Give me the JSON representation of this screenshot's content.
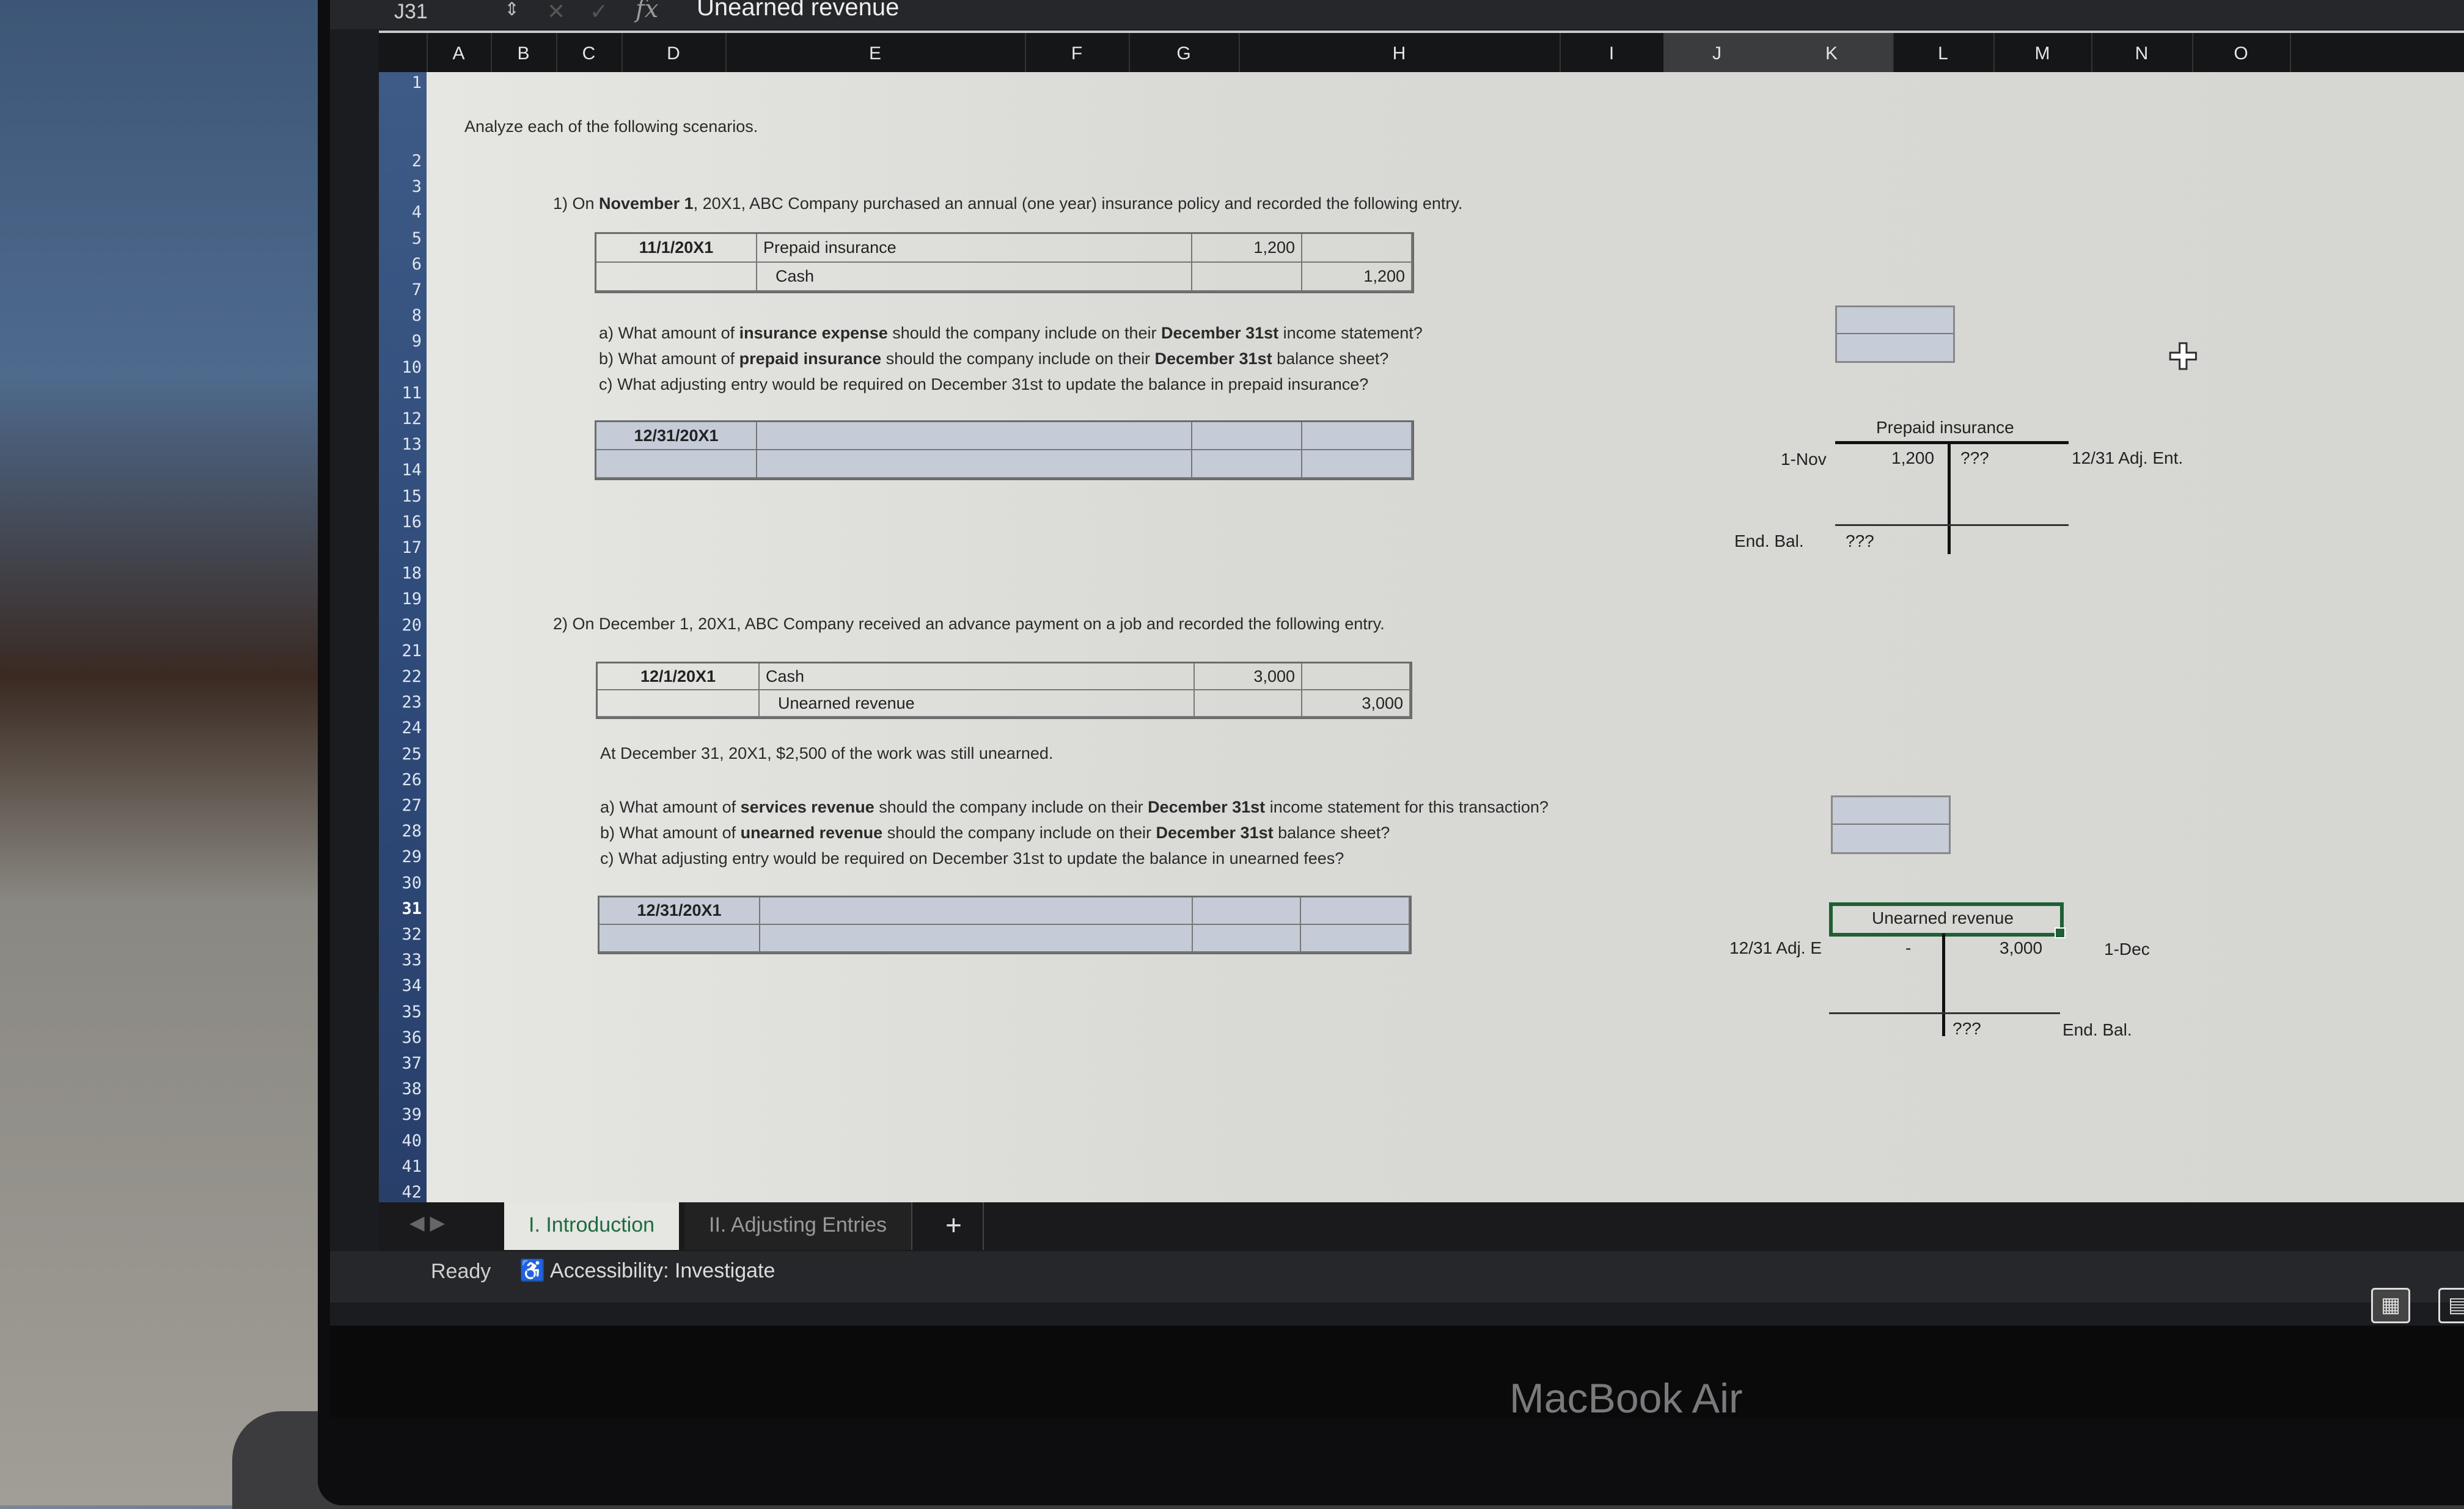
{
  "formula_bar": {
    "name_box": "J31",
    "fx_label": "fx",
    "content": "Unearned revenue"
  },
  "columns": [
    "A",
    "B",
    "C",
    "D",
    "E",
    "F",
    "G",
    "H",
    "I",
    "J",
    "K",
    "L",
    "M",
    "N",
    "O"
  ],
  "selected_columns": [
    "J",
    "K"
  ],
  "rows": [
    "1",
    "2",
    "3",
    "4",
    "5",
    "6",
    "7",
    "8",
    "9",
    "10",
    "11",
    "12",
    "13",
    "14",
    "15",
    "16",
    "17",
    "18",
    "19",
    "20",
    "21",
    "22",
    "23",
    "24",
    "25",
    "26",
    "27",
    "28",
    "29",
    "30",
    "31",
    "32",
    "33",
    "34",
    "35",
    "36",
    "37",
    "38",
    "39",
    "40",
    "41",
    "42"
  ],
  "selected_row": "31",
  "intro": "Analyze each of the following scenarios.",
  "scenario1": {
    "prompt_num": "1) On ",
    "prompt_bold": "November 1",
    "prompt_rest": ", 20X1, ABC Company purchased an annual (one year) insurance policy and recorded the following entry.",
    "entry": [
      {
        "date": "11/1/20X1",
        "account": "Prepaid insurance",
        "debit": "1,200",
        "credit": ""
      },
      {
        "date": "",
        "account": "Cash",
        "debit": "",
        "credit": "1,200"
      }
    ],
    "questions": [
      {
        "pre": "a) What amount of ",
        "bold1": "insurance expense",
        "mid": " should the company include on their ",
        "bold2": "December 31st",
        "post": " income statement?"
      },
      {
        "pre": "b) What amount of ",
        "bold1": "prepaid insurance",
        "mid": " should the company include on their ",
        "bold2": "December 31st",
        "post": " balance sheet?"
      },
      {
        "pre": "c) What adjusting entry would be required on December 31st to update the balance in prepaid insurance?",
        "bold1": "",
        "mid": "",
        "bold2": "",
        "post": ""
      }
    ],
    "adj_entry": [
      {
        "date": "12/31/20X1",
        "account": "",
        "debit": "",
        "credit": ""
      },
      {
        "date": "",
        "account": "",
        "debit": "",
        "credit": ""
      }
    ],
    "t_account": {
      "title": "Prepaid insurance",
      "left_label": "1-Nov",
      "debit_value": "1,200",
      "credit_value": "???",
      "right_label": "12/31 Adj. Ent.",
      "end_label": "End. Bal.",
      "end_value": "???"
    }
  },
  "scenario2": {
    "prompt": "2) On December 1, 20X1, ABC Company received an advance payment on a job and recorded the following entry.",
    "entry": [
      {
        "date": "12/1/20X1",
        "account": "Cash",
        "debit": "3,000",
        "credit": ""
      },
      {
        "date": "",
        "account": "Unearned revenue",
        "debit": "",
        "credit": "3,000"
      }
    ],
    "note": "At December 31, 20X1, $2,500 of the work was still unearned.",
    "questions": [
      {
        "pre": "a) What amount of ",
        "bold1": "services revenue",
        "mid": " should the company include on their ",
        "bold2": "December 31st",
        "post": " income statement for this transaction?"
      },
      {
        "pre": "b) What amount of ",
        "bold1": "unearned revenue",
        "mid": " should the company include on their ",
        "bold2": "December 31st",
        "post": " balance sheet?"
      },
      {
        "pre": "c) What adjusting entry would be required on December 31st to update the balance in unearned fees?",
        "bold1": "",
        "mid": "",
        "bold2": "",
        "post": ""
      }
    ],
    "adj_entry": [
      {
        "date": "12/31/20X1",
        "account": "",
        "debit": "",
        "credit": ""
      },
      {
        "date": "",
        "account": "",
        "debit": "",
        "credit": ""
      }
    ],
    "t_account": {
      "title": "Unearned revenue",
      "left_label": "12/31 Adj. E",
      "debit_value": "-",
      "credit_value": "3,000",
      "right_label": "1-Dec",
      "end_label": "End. Bal.",
      "end_value": "???"
    }
  },
  "sheet_tabs": [
    {
      "label": "I. Introduction",
      "active": true
    },
    {
      "label": "II. Adjusting Entries",
      "active": false
    }
  ],
  "add_sheet_label": "+",
  "status": {
    "ready": "Ready",
    "accessibility": "Accessibility: Investigate"
  },
  "device_brand": "MacBook Air",
  "colors": {
    "selection_green": "#1f5f34",
    "active_tab_text": "#1e6b3f",
    "input_cell_fill": "#c5ccd8"
  }
}
